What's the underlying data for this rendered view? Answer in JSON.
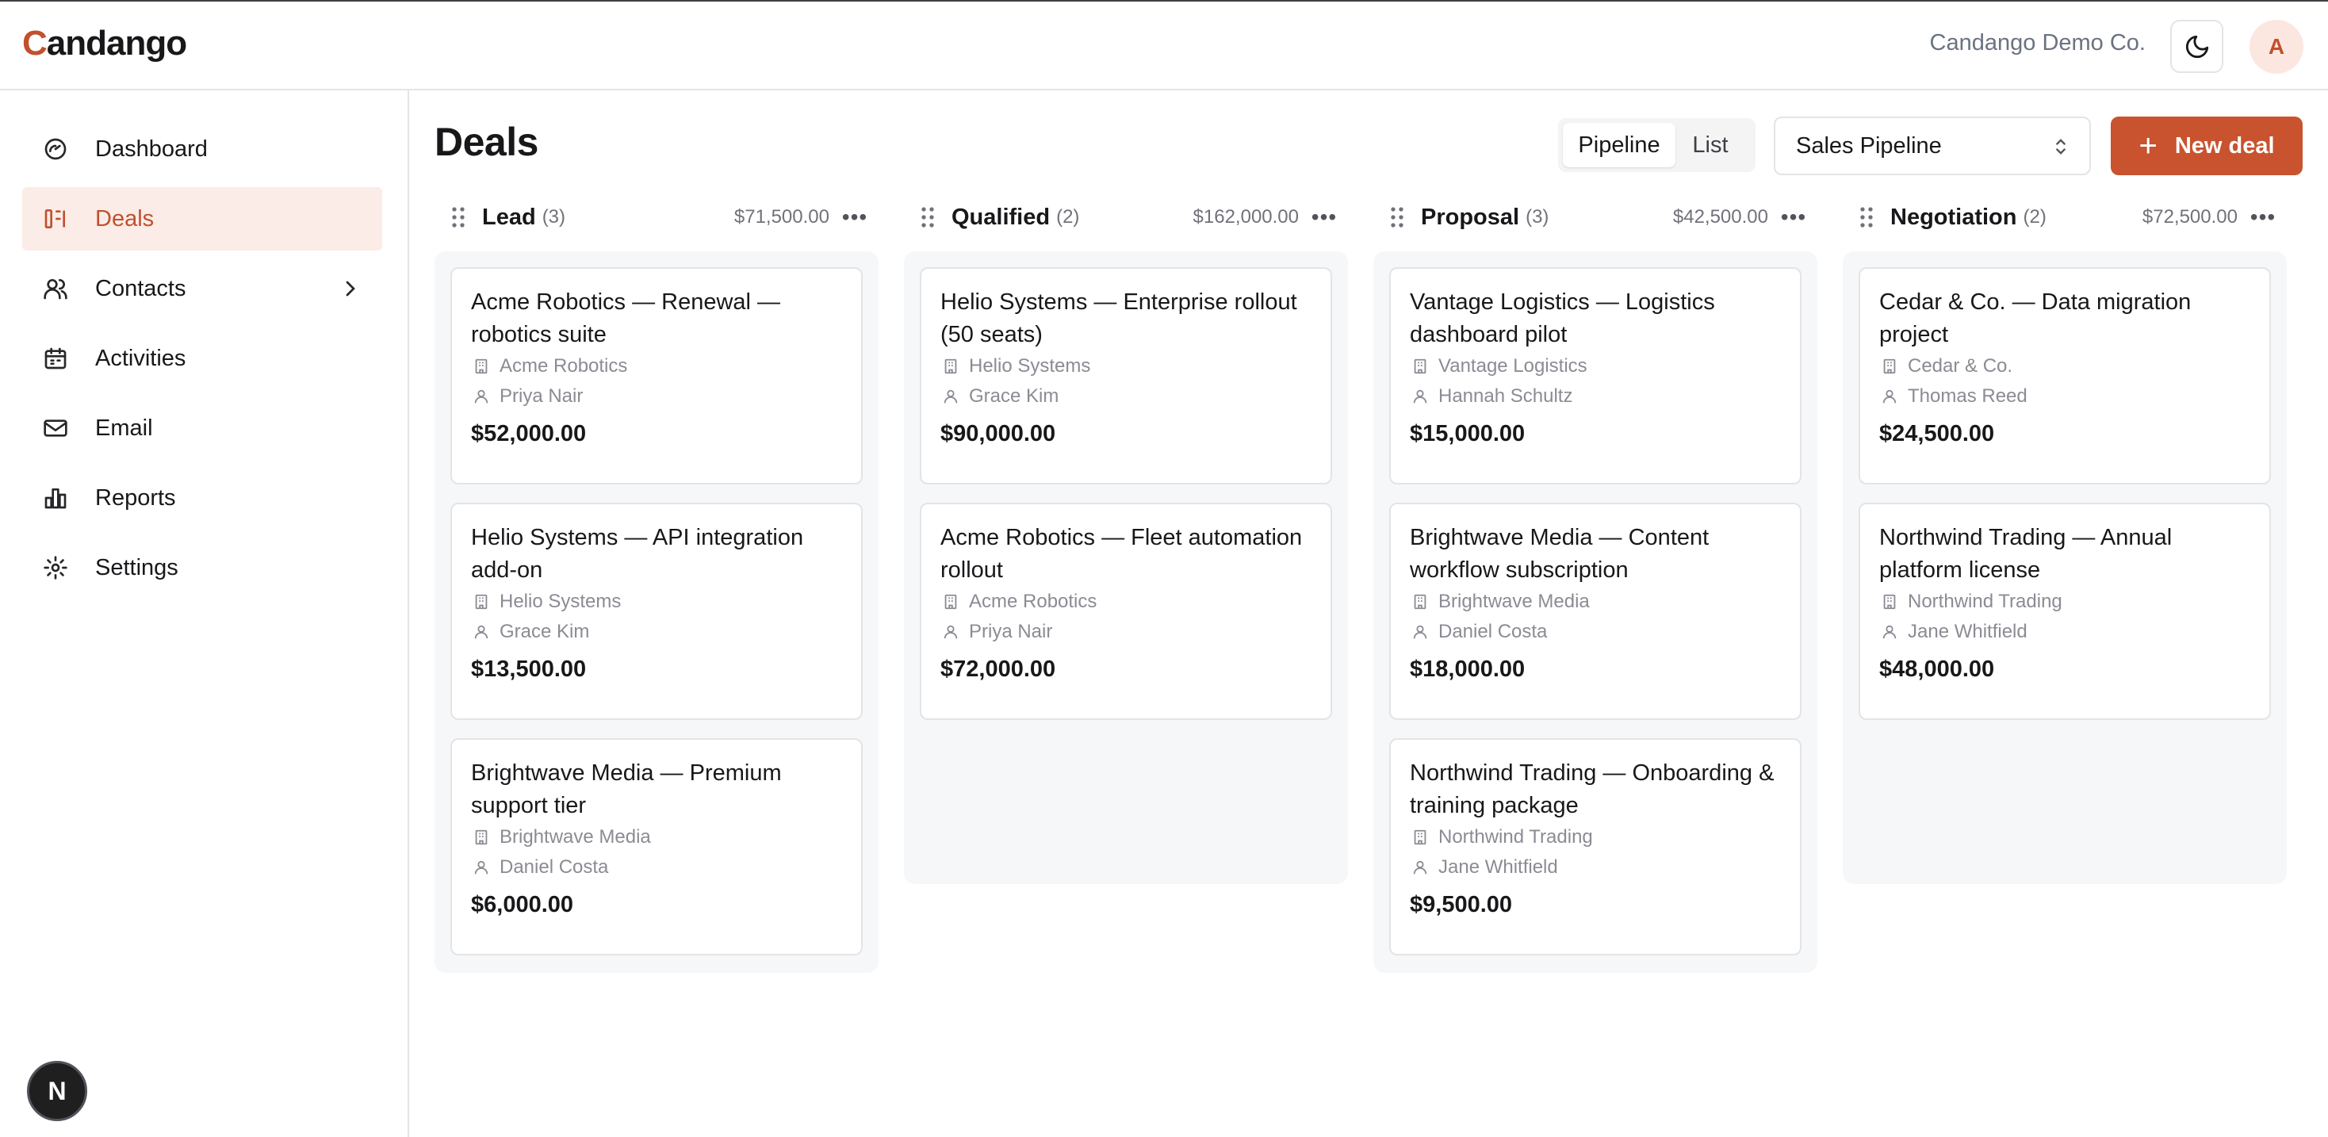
{
  "app": {
    "logo_first": "C",
    "logo_rest": "andango",
    "company": "Candango Demo Co.",
    "avatar_initial": "A",
    "corner_badge": "N"
  },
  "colors": {
    "accent": "#c8532e",
    "active_bg": "#fbece7",
    "column_bg": "#f6f7f9"
  },
  "sidebar": {
    "items": [
      {
        "label": "Dashboard",
        "icon": "gauge-icon",
        "active": false
      },
      {
        "label": "Deals",
        "icon": "kanban-icon",
        "active": true
      },
      {
        "label": "Contacts",
        "icon": "users-icon",
        "active": false,
        "has_submenu": true
      },
      {
        "label": "Activities",
        "icon": "calendar-icon",
        "active": false
      },
      {
        "label": "Email",
        "icon": "mail-icon",
        "active": false
      },
      {
        "label": "Reports",
        "icon": "bar-chart-icon",
        "active": false
      },
      {
        "label": "Settings",
        "icon": "gear-icon",
        "active": false
      }
    ]
  },
  "main": {
    "title": "Deals",
    "view_toggle": {
      "pipeline": "Pipeline",
      "list": "List",
      "selected": "Pipeline"
    },
    "pipeline_select": "Sales Pipeline",
    "new_deal": "New deal"
  },
  "columns": [
    {
      "name": "Lead",
      "count": "(3)",
      "total": "$71,500.00",
      "cards": [
        {
          "title": "Acme Robotics — Renewal — robotics suite",
          "company": "Acme Robotics",
          "contact": "Priya Nair",
          "amount": "$52,000.00"
        },
        {
          "title": "Helio Systems — API integration add-on",
          "company": "Helio Systems",
          "contact": "Grace Kim",
          "amount": "$13,500.00"
        },
        {
          "title": "Brightwave Media — Premium support tier",
          "company": "Brightwave Media",
          "contact": "Daniel Costa",
          "amount": "$6,000.00"
        }
      ]
    },
    {
      "name": "Qualified",
      "count": "(2)",
      "total": "$162,000.00",
      "cards": [
        {
          "title": "Helio Systems — Enterprise rollout (50 seats)",
          "company": "Helio Systems",
          "contact": "Grace Kim",
          "amount": "$90,000.00"
        },
        {
          "title": "Acme Robotics — Fleet automation rollout",
          "company": "Acme Robotics",
          "contact": "Priya Nair",
          "amount": "$72,000.00"
        }
      ]
    },
    {
      "name": "Proposal",
      "count": "(3)",
      "total": "$42,500.00",
      "cards": [
        {
          "title": "Vantage Logistics — Logistics dashboard pilot",
          "company": "Vantage Logistics",
          "contact": "Hannah Schultz",
          "amount": "$15,000.00"
        },
        {
          "title": "Brightwave Media — Content workflow subscription",
          "company": "Brightwave Media",
          "contact": "Daniel Costa",
          "amount": "$18,000.00"
        },
        {
          "title": "Northwind Trading — Onboarding & training package",
          "company": "Northwind Trading",
          "contact": "Jane Whitfield",
          "amount": "$9,500.00"
        }
      ]
    },
    {
      "name": "Negotiation",
      "count": "(2)",
      "total": "$72,500.00",
      "cards": [
        {
          "title": "Cedar & Co. — Data migration project",
          "company": "Cedar & Co.",
          "contact": "Thomas Reed",
          "amount": "$24,500.00"
        },
        {
          "title": "Northwind Trading — Annual platform license",
          "company": "Northwind Trading",
          "contact": "Jane Whitfield",
          "amount": "$48,000.00"
        }
      ]
    }
  ]
}
